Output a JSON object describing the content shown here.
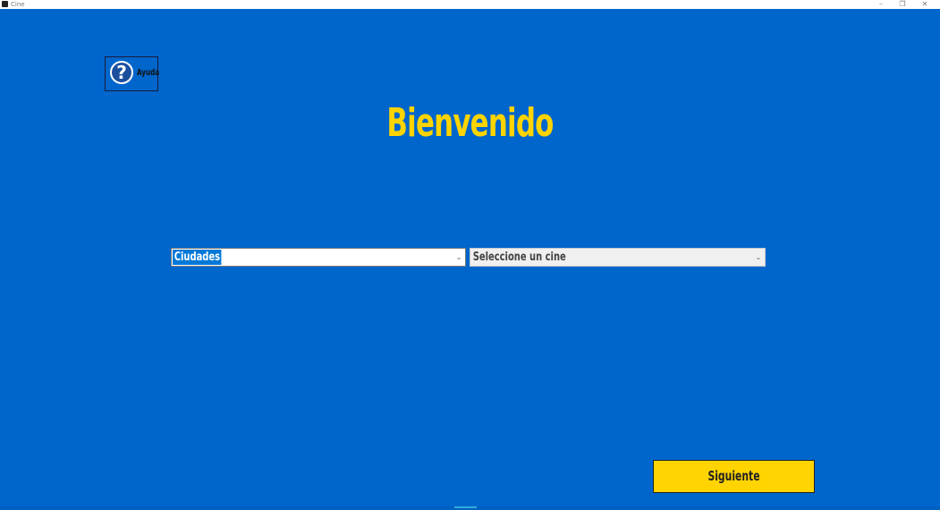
{
  "window": {
    "title": "Cine",
    "minimize_glyph": "–",
    "restore_glyph": "❐",
    "close_glyph": "✕"
  },
  "help": {
    "icon": "help-question-icon",
    "icon_glyph": "?",
    "label": "Ayuda"
  },
  "welcome": {
    "title": "Bienvenido"
  },
  "city_select": {
    "value": "Ciudades",
    "chevron": "⌄"
  },
  "cine_select": {
    "value": "Seleccione un cine",
    "chevron": "⌄"
  },
  "next_button": {
    "label": "Siguiente"
  },
  "colors": {
    "background": "#0066cc",
    "accent_yellow": "#ffd400",
    "selection_blue": "#0078d7"
  }
}
